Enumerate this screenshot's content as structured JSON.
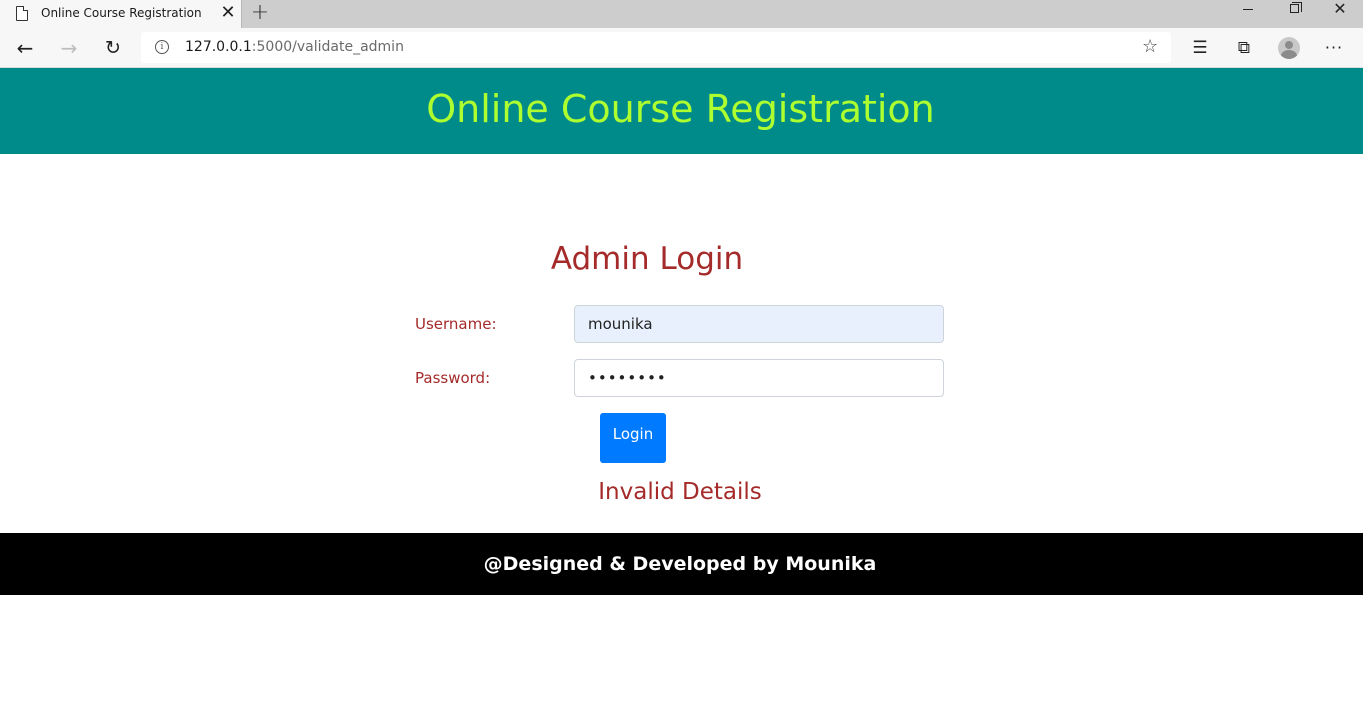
{
  "browser": {
    "tab_title": "Online Course Registration",
    "tab_close": "✕",
    "new_tab": "+",
    "url_host": "127.0.0.1",
    "url_rest": ":5000/validate_admin"
  },
  "header": {
    "title": "Online Course Registration",
    "bg_color": "#008b8b",
    "title_color": "#adff2f"
  },
  "login": {
    "heading": "Admin Login",
    "username_label": "Username:",
    "username_value": "mounika",
    "password_label": "Password:",
    "password_value": "mounika1",
    "button_label": "Login",
    "button_color": "#007bff",
    "error_message": "Invalid Details",
    "text_color": "#a52a2a"
  },
  "footer": {
    "text": "@Designed & Developed by Mounika"
  }
}
